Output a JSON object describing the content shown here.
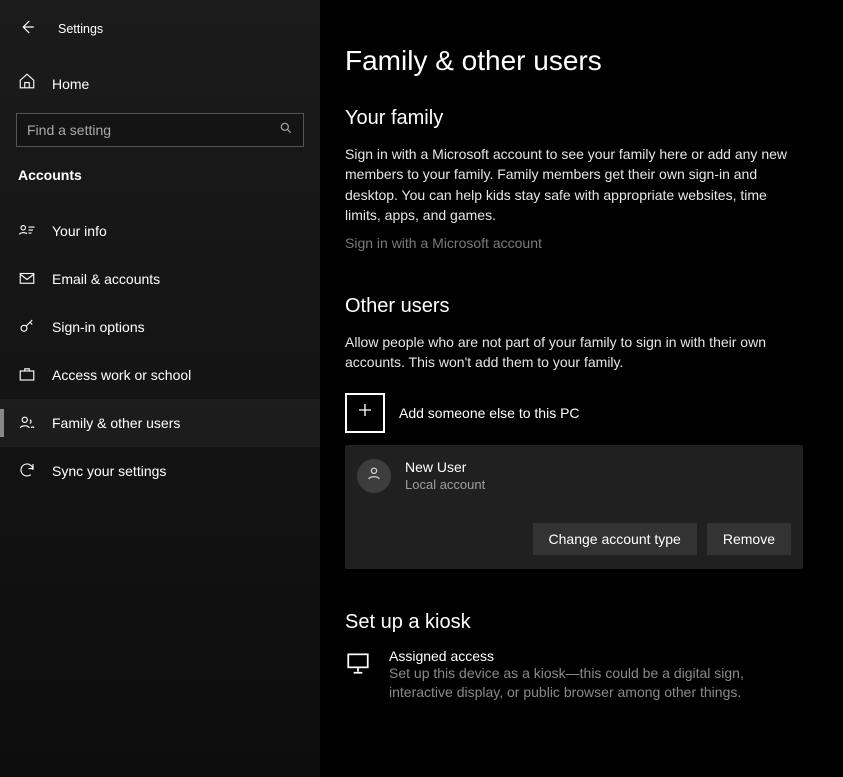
{
  "window": {
    "title": "Settings"
  },
  "sidebar": {
    "home": "Home",
    "search_placeholder": "Find a setting",
    "category": "Accounts",
    "items": [
      {
        "label": "Your info"
      },
      {
        "label": "Email & accounts"
      },
      {
        "label": "Sign-in options"
      },
      {
        "label": "Access work or school"
      },
      {
        "label": "Family & other users"
      },
      {
        "label": "Sync your settings"
      }
    ]
  },
  "main": {
    "page_title": "Family & other users",
    "family": {
      "heading": "Your family",
      "description": "Sign in with a Microsoft account to see your family here or add any new members to your family. Family members get their own sign-in and desktop. You can help kids stay safe with appropriate websites, time limits, apps, and games.",
      "link": "Sign in with a Microsoft account"
    },
    "other": {
      "heading": "Other users",
      "description": "Allow people who are not part of your family to sign in with their own accounts. This won't add them to your family.",
      "add_label": "Add someone else to this PC",
      "user": {
        "name": "New User",
        "type": "Local account"
      },
      "change_btn": "Change account type",
      "remove_btn": "Remove"
    },
    "kiosk": {
      "heading": "Set up a kiosk",
      "title": "Assigned access",
      "description": "Set up this device as a kiosk—this could be a digital sign, interactive display, or public browser among other things."
    }
  }
}
